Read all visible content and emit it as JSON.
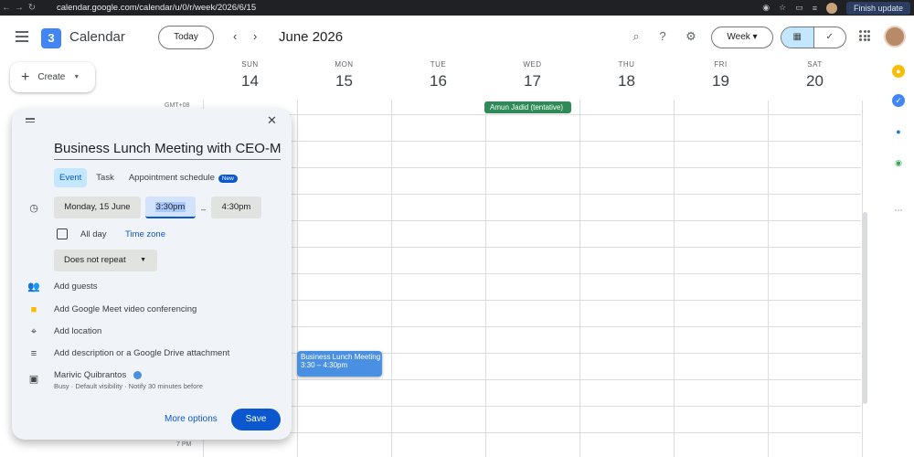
{
  "browser": {
    "url": "calendar.google.com/calendar/u/0/r/week/2026/6/15",
    "finish_update": "Finish update"
  },
  "header": {
    "logo_number": "3",
    "app_title": "Calendar",
    "today_label": "Today",
    "month_label": "June 2026",
    "view_label": "Week"
  },
  "sidebar": {
    "create_label": "Create"
  },
  "days": [
    {
      "name": "SUN",
      "date": "14"
    },
    {
      "name": "MON",
      "date": "15"
    },
    {
      "name": "TUE",
      "date": "16"
    },
    {
      "name": "WED",
      "date": "17"
    },
    {
      "name": "THU",
      "date": "18"
    },
    {
      "name": "FRI",
      "date": "19"
    },
    {
      "name": "SAT",
      "date": "20"
    }
  ],
  "grid": {
    "timezone": "GMT+08",
    "time_label_bottom": "7 PM"
  },
  "events": {
    "allday_title": "Amun Jadid (tentative)",
    "lunch_title": "Business Lunch Meeting",
    "lunch_time": "3:30 – 4:30pm"
  },
  "dialog": {
    "title": "Business Lunch Meeting with CEO-M",
    "tabs": {
      "event": "Event",
      "task": "Task",
      "appointment": "Appointment schedule",
      "new_badge": "New"
    },
    "date": "Monday, 15 June",
    "start_time": "3:30pm",
    "dash": "–",
    "end_time": "4:30pm",
    "all_day": "All day",
    "time_zone": "Time zone",
    "repeat": "Does not repeat",
    "add_guests": "Add guests",
    "add_meet": "Add Google Meet video conferencing",
    "add_location": "Add location",
    "add_description": "Add description or a Google Drive attachment",
    "owner_name": "Marivic Quibrantos",
    "owner_details": "Busy · Default visibility · Notify 30 minutes before",
    "more_options": "More options",
    "save": "Save"
  }
}
